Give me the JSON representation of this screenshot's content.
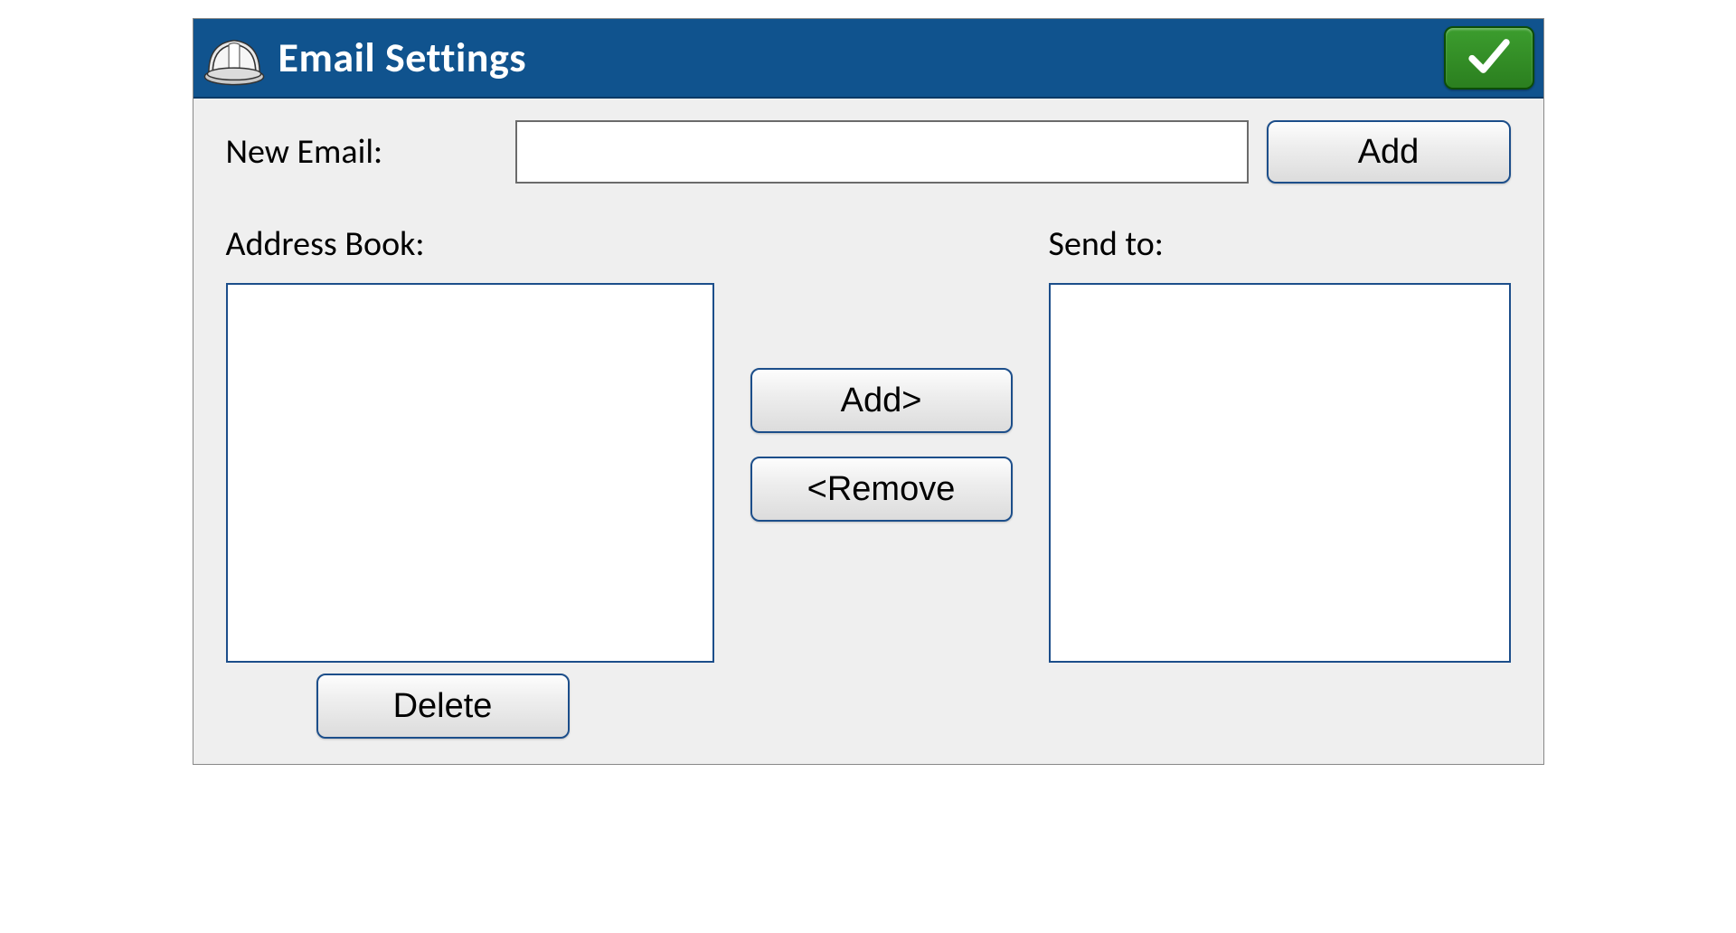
{
  "header": {
    "title": "Email Settings"
  },
  "form": {
    "new_email_label": "New Email:",
    "new_email_value": "",
    "add_button": "Add",
    "address_book_label": "Address Book:",
    "send_to_label": "Send to:",
    "delete_button": "Delete",
    "add_to_button": "Add>",
    "remove_button": "<Remove",
    "address_book_items": [],
    "send_to_items": []
  }
}
